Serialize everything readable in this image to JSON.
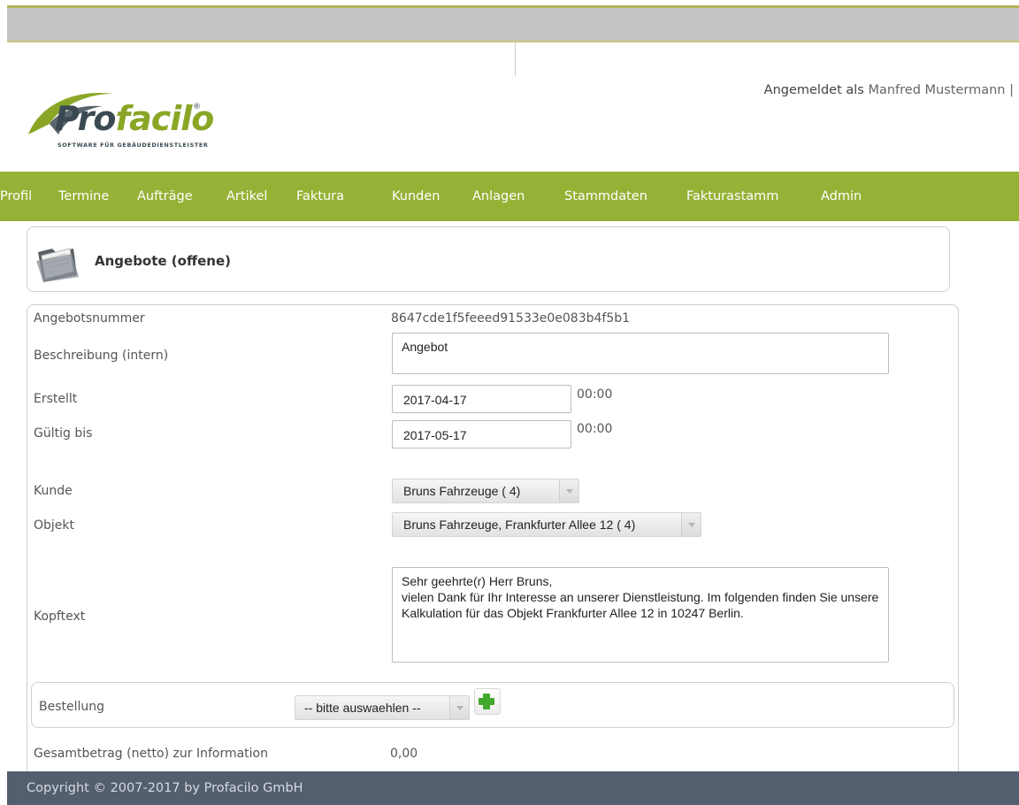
{
  "logo": {
    "brand_part1": "Pro",
    "brand_part2": "facilo",
    "registered": "®",
    "tagline": "SOFTWARE FÜR GEBÄUDEDIENSTLEISTER"
  },
  "login": {
    "prefix": "Angemeldet als",
    "user": "Manfred Mustermann",
    "separator": "|"
  },
  "nav": [
    "Profil",
    "Termine",
    "Aufträge",
    "Artikel",
    "Faktura",
    "Kunden",
    "Anlagen",
    "Stammdaten",
    "Fakturastamm",
    "Admin"
  ],
  "page": {
    "title": "Angebote (offene)"
  },
  "form": {
    "angebotsnummer_label": "Angebotsnummer",
    "angebotsnummer_value": "8647cde1f5feeed91533e0e083b4f5b1",
    "beschreibung_label": "Beschreibung (intern)",
    "beschreibung_value": "Angebot",
    "erstellt_label": "Erstellt",
    "erstellt_date": "2017-04-17",
    "erstellt_time": "00:00",
    "gueltig_label": "Gültig bis",
    "gueltig_date": "2017-05-17",
    "gueltig_time": "00:00",
    "kunde_label": "Kunde",
    "kunde_value": "Bruns Fahrzeuge ( 4)",
    "objekt_label": "Objekt",
    "objekt_value": "Bruns Fahrzeuge, Frankfurter Allee 12 ( 4)",
    "kopftext_label": "Kopftext",
    "kopftext_value": "Sehr geehrte(r) Herr Bruns,\nvielen Dank für Ihr Interesse an unserer Dienstleistung. Im folgenden finden Sie unsere Kalkulation für das Objekt Frankfurter Allee 12 in 10247 Berlin.",
    "bestellung_label": "Bestellung",
    "bestellung_value": "-- bitte auswaehlen --",
    "gesamt_label": "Gesamtbetrag (netto) zur Information",
    "gesamt_value": "0,00"
  },
  "footer": {
    "copyright": "Copyright © 2007-2017 by Profacilo GmbH"
  },
  "colors": {
    "nav_bg": "#95b236",
    "footer_bg": "#535e6e",
    "brand_green": "#8aa626",
    "brand_dark": "#3b4a52",
    "plus_green": "#43a82e"
  }
}
